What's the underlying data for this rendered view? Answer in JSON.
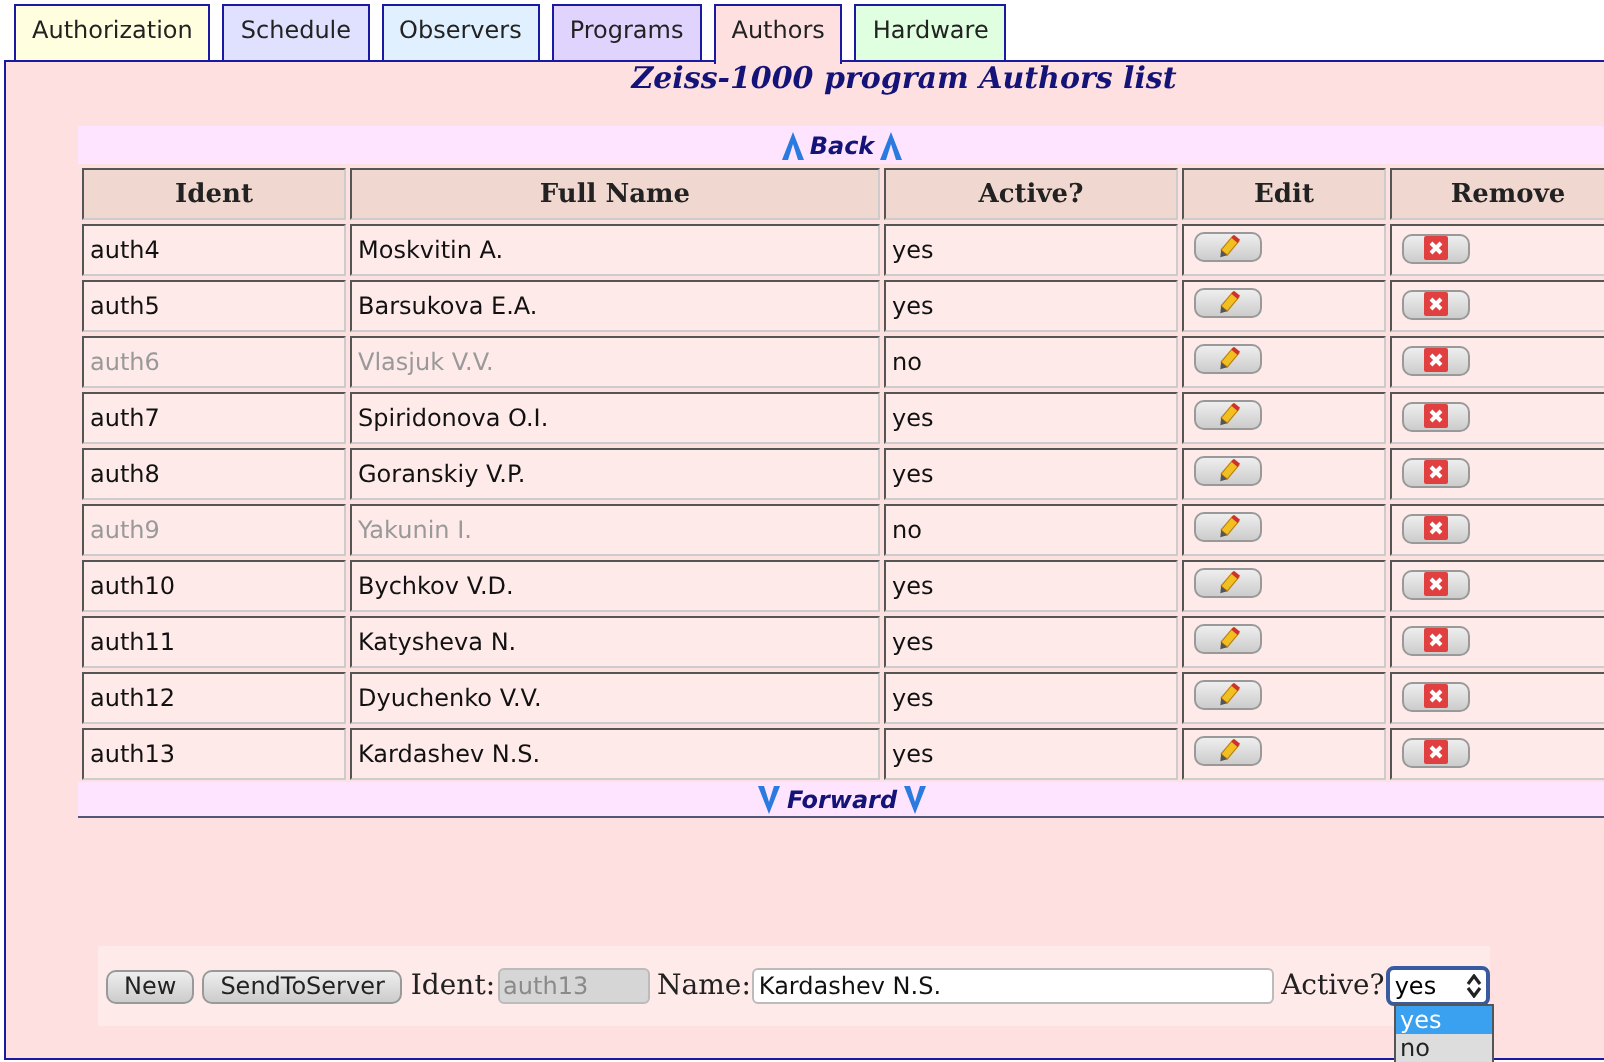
{
  "tabs": [
    {
      "label": "Authorization",
      "selected": false,
      "color": "#ffffe0"
    },
    {
      "label": "Schedule",
      "selected": false,
      "color": "#e0e0ff"
    },
    {
      "label": "Observers",
      "selected": false,
      "color": "#e0f0ff"
    },
    {
      "label": "Programs",
      "selected": false,
      "color": "#e0d4ff"
    },
    {
      "label": "Authors",
      "selected": true,
      "color": "#ffe0e0"
    },
    {
      "label": "Hardware",
      "selected": false,
      "color": "#e0ffe0"
    }
  ],
  "title": "Zeiss-1000 program Authors list",
  "back_link": "Back",
  "table": {
    "columns": [
      "Ident",
      "Full Name",
      "Active?",
      "Edit",
      "Remove"
    ],
    "rows": [
      {
        "ident": "auth4",
        "name": "Moskvitin A.",
        "active": "yes",
        "disabled": false
      },
      {
        "ident": "auth5",
        "name": "Barsukova E.A.",
        "active": "yes",
        "disabled": false
      },
      {
        "ident": "auth6",
        "name": "Vlasjuk V.V.",
        "active": "no",
        "disabled": true
      },
      {
        "ident": "auth7",
        "name": "Spiridonova O.I.",
        "active": "yes",
        "disabled": false
      },
      {
        "ident": "auth8",
        "name": "Goranskiy V.P.",
        "active": "yes",
        "disabled": false
      },
      {
        "ident": "auth9",
        "name": "Yakunin I.",
        "active": "no",
        "disabled": true
      },
      {
        "ident": "auth10",
        "name": "Bychkov V.D.",
        "active": "yes",
        "disabled": false
      },
      {
        "ident": "auth11",
        "name": "Katysheva N.",
        "active": "yes",
        "disabled": false
      },
      {
        "ident": "auth12",
        "name": "Dyuchenko V.V.",
        "active": "yes",
        "disabled": false
      },
      {
        "ident": "auth13",
        "name": "Kardashev N.S.",
        "active": "yes",
        "disabled": false
      }
    ]
  },
  "forward_link": "Forward",
  "form": {
    "buttons": [
      "New",
      "SendToServer"
    ],
    "ident": {
      "label": "Ident:",
      "value": "auth13",
      "disabled": true
    },
    "name": {
      "label": "Name:",
      "value": "Kardashev N.S."
    },
    "active": {
      "label": "Active?",
      "value": "yes",
      "expanded": true,
      "options": [
        {
          "label": "yes",
          "selected": true
        },
        {
          "label": "no",
          "selected": false
        }
      ]
    }
  }
}
